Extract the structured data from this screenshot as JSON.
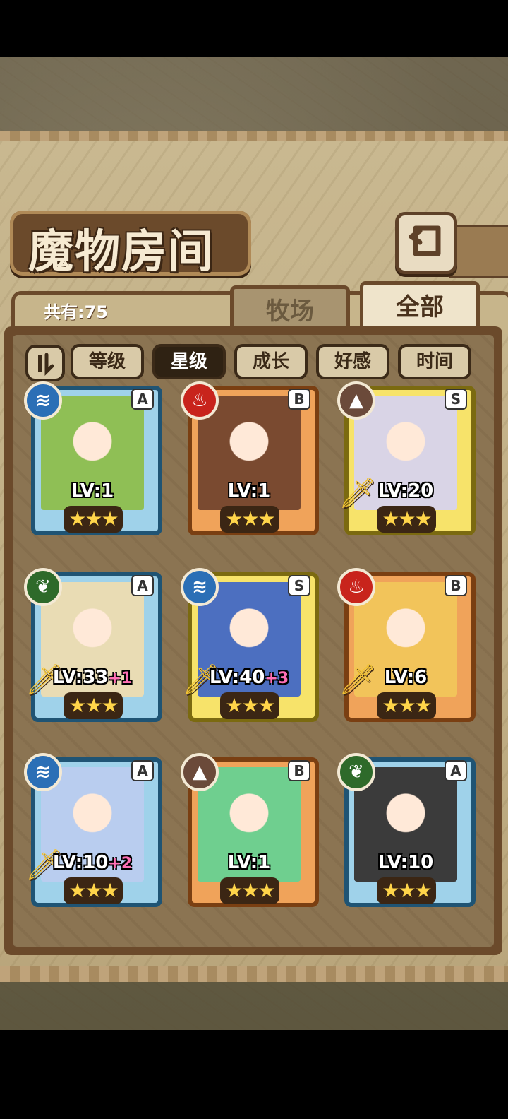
{
  "header": {
    "title": "魔物房间",
    "back_icon": "back-arrow-icon"
  },
  "summary": {
    "count_label": "共有:75"
  },
  "tabs": [
    {
      "label": "牧场",
      "selected": false
    },
    {
      "label": "全部",
      "selected": true
    }
  ],
  "sort": {
    "toggle_icon": "pause-order-icon",
    "buttons": [
      {
        "label": "等级",
        "active": false
      },
      {
        "label": "星级",
        "active": true
      },
      {
        "label": "成长",
        "active": false
      },
      {
        "label": "好感",
        "active": false
      },
      {
        "label": "时间",
        "active": false
      }
    ]
  },
  "monsters": [
    {
      "rank": "A",
      "element": "water",
      "element_glyph": "≋",
      "level": "LV:1",
      "plus": "",
      "stars": "★★★",
      "equipped": false,
      "art_color": "#8fbf55"
    },
    {
      "rank": "B",
      "element": "fire",
      "element_glyph": "♨",
      "level": "LV:1",
      "plus": "",
      "stars": "★★★",
      "equipped": false,
      "art_color": "#7a4a30"
    },
    {
      "rank": "S",
      "element": "earth",
      "element_glyph": "▲",
      "level": "LV:20",
      "plus": "",
      "stars": "★★★",
      "equipped": true,
      "art_color": "#d9d4e6"
    },
    {
      "rank": "A",
      "element": "wood",
      "element_glyph": "❦",
      "level": "LV:33",
      "plus": "+1",
      "stars": "★★★",
      "equipped": true,
      "art_color": "#e9dcb4"
    },
    {
      "rank": "S",
      "element": "water",
      "element_glyph": "≋",
      "level": "LV:40",
      "plus": "+3",
      "stars": "★★★",
      "equipped": true,
      "art_color": "#4c6fc0"
    },
    {
      "rank": "B",
      "element": "fire",
      "element_glyph": "♨",
      "level": "LV:6",
      "plus": "",
      "stars": "★★★",
      "equipped": true,
      "art_color": "#f2c45a"
    },
    {
      "rank": "A",
      "element": "water",
      "element_glyph": "≋",
      "level": "LV:10",
      "plus": "+2",
      "stars": "★★★",
      "equipped": true,
      "art_color": "#b9cdef"
    },
    {
      "rank": "B",
      "element": "earth",
      "element_glyph": "▲",
      "level": "LV:1",
      "plus": "",
      "stars": "★★★",
      "equipped": false,
      "art_color": "#6fcf8f"
    },
    {
      "rank": "A",
      "element": "wood",
      "element_glyph": "❦",
      "level": "LV:10",
      "plus": "",
      "stars": "★★★",
      "equipped": false,
      "art_color": "#3b3b3b"
    }
  ]
}
